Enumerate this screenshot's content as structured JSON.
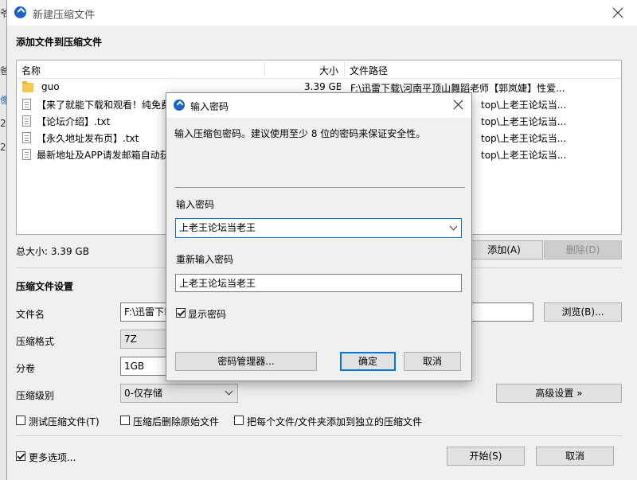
{
  "main": {
    "title": "新建压缩文件",
    "section_add": "添加文件到压缩文件",
    "columns": [
      "名称",
      "大小",
      "文件路径"
    ],
    "files": [
      {
        "name": "guo",
        "size": "3.39 GB",
        "path": "F:\\迅雷下载\\河南平顶山舞蹈老师【郭岚婕】性爱...",
        "icon": "folder-icon"
      },
      {
        "name": "【来了就能下载和观看！纯免费",
        "size": "",
        "path": "top\\上老王论坛当...",
        "icon": "file-icon"
      },
      {
        "name": "【论坛介绍】.txt",
        "size": "",
        "path": "top\\上老王论坛当...",
        "icon": "file-icon"
      },
      {
        "name": "【永久地址发布页】.txt",
        "size": "",
        "path": "top\\上老王论坛当...",
        "icon": "file-icon"
      },
      {
        "name": "最新地址及APP请发邮箱自动获",
        "size": "",
        "path": "top\\上老王论坛当...",
        "icon": "file-icon"
      }
    ],
    "total_size": "总大小: 3.39 GB",
    "add_button": "添加(A)",
    "delete_button": "删除(D)",
    "settings_title": "压缩文件设置",
    "filename_label": "文件名",
    "filename_value": "F:\\迅雷下载",
    "browse_button": "浏览(B)...",
    "format_label": "压缩格式",
    "format_value": "7Z",
    "split_label": "分卷",
    "split_value": "1GB",
    "level_label": "压缩级别",
    "level_value": "0-仅存储",
    "advanced_button": "高级设置 »",
    "chk_test": "测试压缩文件(T)",
    "chk_delete": "压缩后删除原始文件",
    "chk_each": "把每个文件/文件夹添加到独立的压缩文件",
    "chk_more": "更多选项...",
    "start_button": "开始(S)",
    "cancel_button": "取消"
  },
  "dialog": {
    "title": "输入密码",
    "description": "输入压缩包密码。建议使用至少 8 位的密码来保证安全性。",
    "password_label": "输入密码",
    "password_value": "上老王论坛当老王",
    "confirm_label": "重新输入密码",
    "confirm_value": "上老王论坛当老王",
    "show_password": "显示密码",
    "manager_button": "密码管理器...",
    "ok_button": "确定",
    "cancel_button": "取消"
  },
  "background_fragments": [
    "爷",
    "爸",
    "像",
    "2e",
    "2C"
  ]
}
